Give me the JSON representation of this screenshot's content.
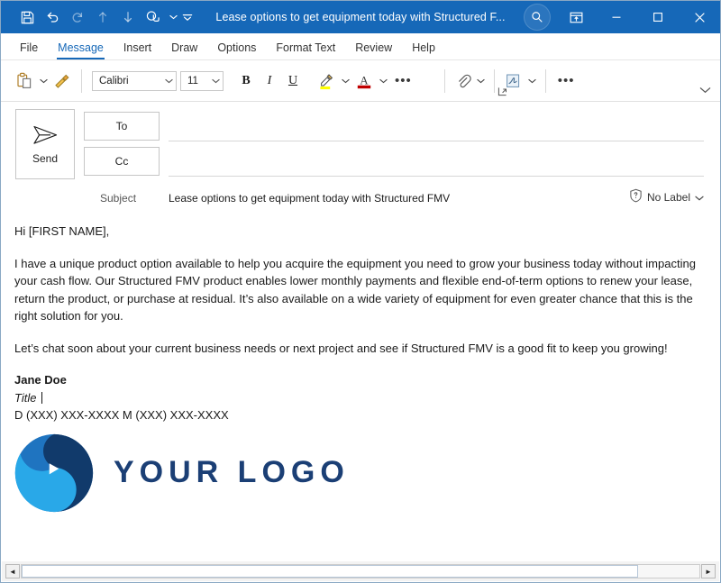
{
  "window": {
    "title": "Lease options to get equipment today with Structured F...",
    "titlebar_color": "#1668b8",
    "quick_access": [
      {
        "name": "save-icon",
        "label": "Save"
      },
      {
        "name": "undo-icon",
        "label": "Undo"
      },
      {
        "name": "redo-icon",
        "label": "Redo"
      },
      {
        "name": "move-up-icon",
        "label": "Previous Item"
      },
      {
        "name": "move-down-icon",
        "label": "Next Item"
      },
      {
        "name": "touch-mode-icon",
        "label": "Touch/Mouse Mode"
      }
    ],
    "controls": {
      "search": "Search",
      "ribbon_display_options": "Ribbon Display Options",
      "minimize": "Minimize",
      "maximize": "Maximize",
      "close": "Close"
    }
  },
  "tabs": [
    {
      "label": "File",
      "active": false
    },
    {
      "label": "Message",
      "active": true
    },
    {
      "label": "Insert",
      "active": false
    },
    {
      "label": "Draw",
      "active": false
    },
    {
      "label": "Options",
      "active": false
    },
    {
      "label": "Format Text",
      "active": false
    },
    {
      "label": "Review",
      "active": false
    },
    {
      "label": "Help",
      "active": false
    }
  ],
  "ribbon": {
    "paste_label": "Paste",
    "format_painter_label": "Format Painter",
    "font": {
      "value": "Calibri",
      "placeholder": "Font"
    },
    "font_size": {
      "value": "11",
      "placeholder": "Size"
    },
    "bold": "B",
    "italic": "I",
    "underline": "U",
    "highlight_label": "Text Highlight Color",
    "font_color_label": "Font Color",
    "font_color_swatch": "#c00000",
    "highlight_swatch": "#ffff00",
    "more_font_label": "More font options",
    "font_dialog_launcher": "Font dialog launcher",
    "attach_label": "Attach File",
    "signature_label": "Signature",
    "more_label": "More commands",
    "collapse_ribbon_label": "Collapse the Ribbon"
  },
  "compose": {
    "send_label": "Send",
    "to_label": "To",
    "cc_label": "Cc",
    "to_value": "",
    "cc_value": "",
    "subject_label": "Subject",
    "subject_value": "Lease options to get equipment today with Structured FMV",
    "sensitivity_label": "No Label"
  },
  "message_body": {
    "greeting": "Hi [FIRST NAME],",
    "paragraph_1": "I have a unique product option available to help you acquire the equipment you need to grow your business today without impacting your cash flow. Our Structured FMV product enables lower monthly payments and flexible end-of-term options to renew your lease, return the product, or purchase at residual. It’s also available on a wide variety of equipment for even greater chance that this is the right solution for you.",
    "paragraph_2": "Let’s chat soon about your current business needs or next project and see if Structured FMV is a good fit to keep you growing!",
    "signature": {
      "name": "Jane Doe",
      "title": "Title",
      "phones": "D (XXX) XXX-XXXX    M (XXX) XXX-XXXX"
    },
    "logo": {
      "text": "YOUR LOGO",
      "text_color": "#1b3f75",
      "color_dark": "#113a6b",
      "color_mid": "#1f74c0",
      "color_light": "#29a8e8"
    }
  },
  "scrollbar": {
    "left_arrow": "◄",
    "right_arrow": "►"
  }
}
